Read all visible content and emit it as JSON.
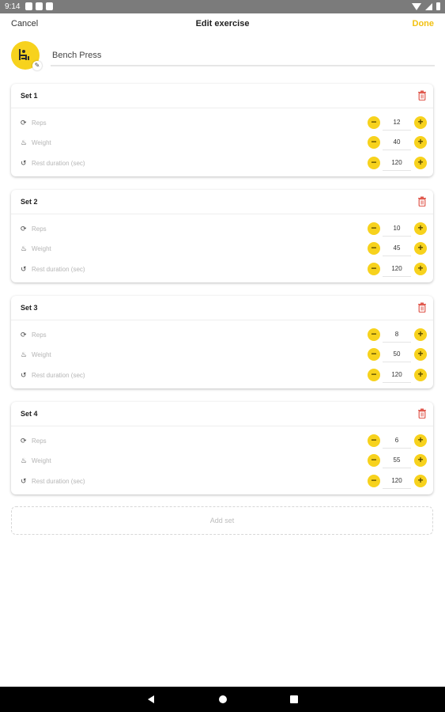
{
  "status_bar": {
    "time": "9:14"
  },
  "header": {
    "cancel": "Cancel",
    "title": "Edit exercise",
    "done": "Done"
  },
  "exercise": {
    "name": "Bench Press"
  },
  "labels": {
    "reps": "Reps",
    "weight": "Weight",
    "rest": "Rest duration (sec)"
  },
  "sets": [
    {
      "title": "Set 1",
      "reps": "12",
      "weight": "40",
      "rest": "120"
    },
    {
      "title": "Set 2",
      "reps": "10",
      "weight": "45",
      "rest": "120"
    },
    {
      "title": "Set 3",
      "reps": "8",
      "weight": "50",
      "rest": "120"
    },
    {
      "title": "Set 4",
      "reps": "6",
      "weight": "55",
      "rest": "120"
    }
  ],
  "add_set": "Add set",
  "icons": {
    "row_reps": "refresh-icon",
    "row_weight": "fire-icon",
    "row_rest": "history-icon",
    "delete": "trash-icon"
  },
  "colors": {
    "accent": "#f7d21d",
    "done": "#f2c111",
    "delete": "#e05a4f"
  }
}
